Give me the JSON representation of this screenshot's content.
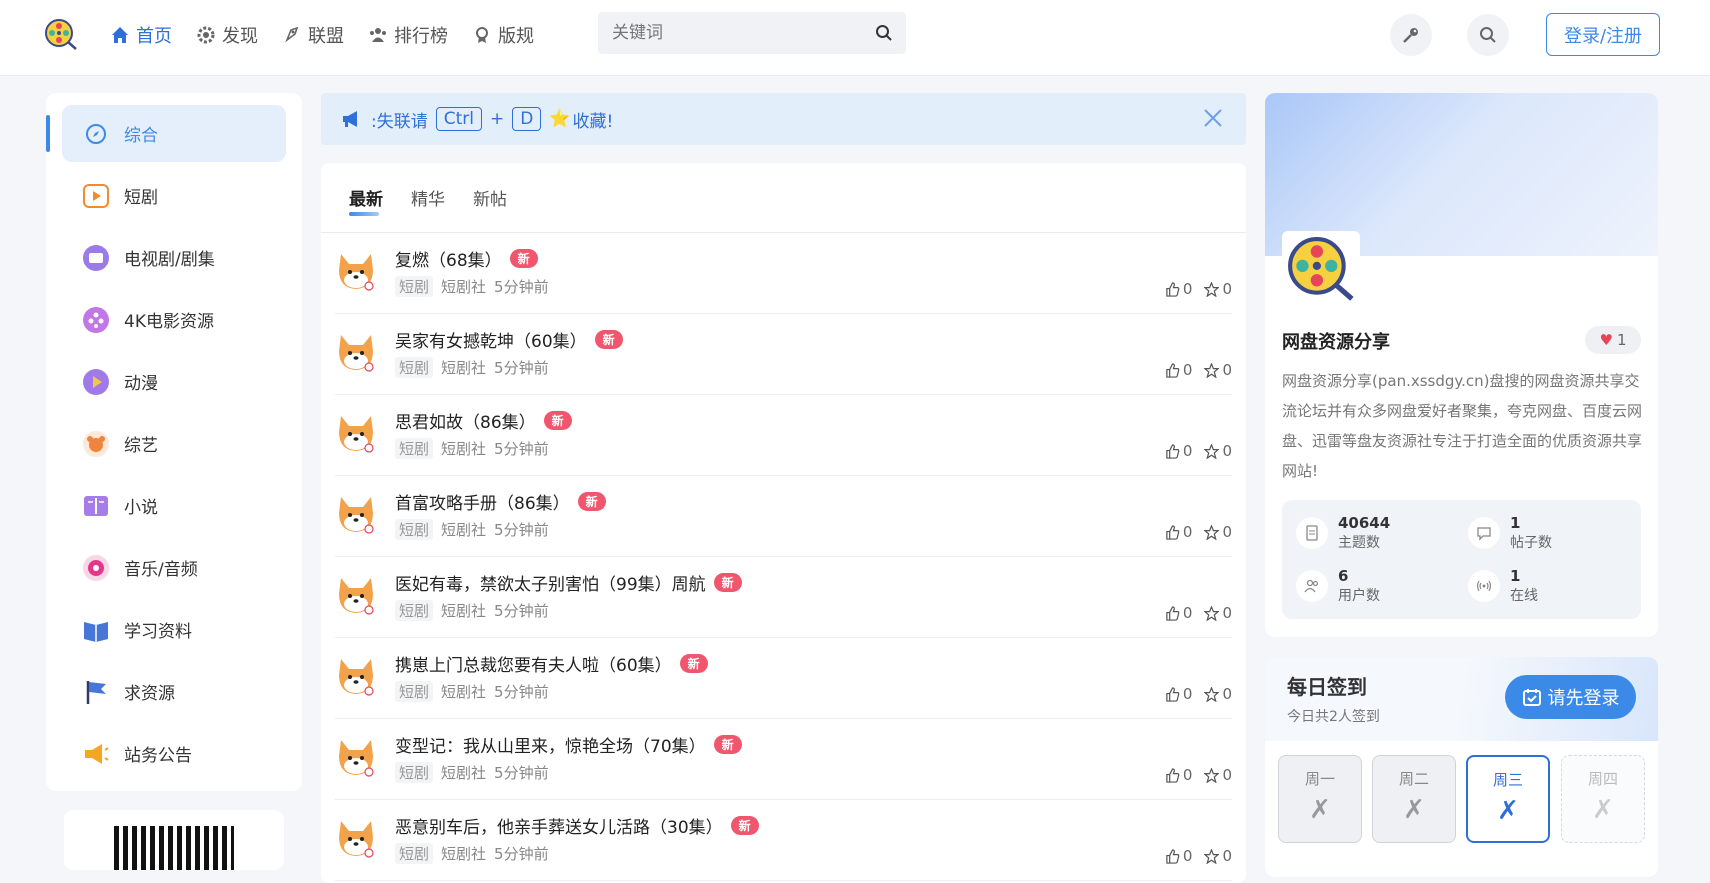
{
  "header": {
    "nav": [
      {
        "label": "首页",
        "icon": "home-icon"
      },
      {
        "label": "发现",
        "icon": "gear-icon"
      },
      {
        "label": "联盟",
        "icon": "rocket-icon"
      },
      {
        "label": "排行榜",
        "icon": "users-icon"
      },
      {
        "label": "版规",
        "icon": "award-icon"
      }
    ],
    "search_placeholder": "关键词",
    "login_label": "登录/注册"
  },
  "sidebar": {
    "items": [
      {
        "label": "综合",
        "icon": "compass-icon"
      },
      {
        "label": "短剧",
        "icon": "play-icon"
      },
      {
        "label": "电视剧/剧集",
        "icon": "tv-icon"
      },
      {
        "label": "4K电影资源",
        "icon": "film-reel-icon"
      },
      {
        "label": "动漫",
        "icon": "play-circle-icon"
      },
      {
        "label": "综艺",
        "icon": "bear-icon"
      },
      {
        "label": "小说",
        "icon": "book-icon"
      },
      {
        "label": "音乐/音频",
        "icon": "music-disc-icon"
      },
      {
        "label": "学习资料",
        "icon": "open-book-icon"
      },
      {
        "label": "求资源",
        "icon": "flag-icon"
      },
      {
        "label": "站务公告",
        "icon": "megaphone-icon"
      }
    ]
  },
  "notice": {
    "text_before": ":失联请",
    "key1": "Ctrl",
    "plus": "+",
    "key2": "D",
    "text_after": "收藏!"
  },
  "feed": {
    "tabs": [
      "最新",
      "精华",
      "新帖"
    ],
    "posts": [
      {
        "title": "复燃（68集）",
        "badge": "新",
        "tag": "短剧",
        "forum": "短剧社",
        "time": "5分钟前",
        "likes": "0",
        "favs": "0"
      },
      {
        "title": "吴家有女撼乾坤（60集）",
        "badge": "新",
        "tag": "短剧",
        "forum": "短剧社",
        "time": "5分钟前",
        "likes": "0",
        "favs": "0"
      },
      {
        "title": "思君如故（86集）",
        "badge": "新",
        "tag": "短剧",
        "forum": "短剧社",
        "time": "5分钟前",
        "likes": "0",
        "favs": "0"
      },
      {
        "title": "首富攻略手册（86集）",
        "badge": "新",
        "tag": "短剧",
        "forum": "短剧社",
        "time": "5分钟前",
        "likes": "0",
        "favs": "0"
      },
      {
        "title": "医妃有毒，禁欲太子别害怕（99集）周航",
        "badge": "新",
        "tag": "短剧",
        "forum": "短剧社",
        "time": "5分钟前",
        "likes": "0",
        "favs": "0"
      },
      {
        "title": "携崽上门总裁您要有夫人啦（60集）",
        "badge": "新",
        "tag": "短剧",
        "forum": "短剧社",
        "time": "5分钟前",
        "likes": "0",
        "favs": "0"
      },
      {
        "title": "变型记：我从山里来，惊艳全场（70集）",
        "badge": "新",
        "tag": "短剧",
        "forum": "短剧社",
        "time": "5分钟前",
        "likes": "0",
        "favs": "0"
      },
      {
        "title": "恶意别车后，他亲手葬送女儿活路（30集）",
        "badge": "新",
        "tag": "短剧",
        "forum": "短剧社",
        "time": "5分钟前",
        "likes": "0",
        "favs": "0"
      }
    ]
  },
  "profile": {
    "name": "网盘资源分享",
    "likes": "1",
    "description": "网盘资源分享(pan.xssdgy.cn)盘搜的网盘资源共享交流论坛并有众多网盘爱好者聚集，夸克网盘、百度云网盘、迅雷等盘友资源社专注于打造全面的优质资源共享网站!",
    "stats": [
      {
        "value": "40644",
        "label": "主题数",
        "icon": "document-icon"
      },
      {
        "value": "1",
        "label": "帖子数",
        "icon": "comment-icon"
      },
      {
        "value": "6",
        "label": "用户数",
        "icon": "users-icon"
      },
      {
        "value": "1",
        "label": "在线",
        "icon": "broadcast-icon"
      }
    ]
  },
  "signin": {
    "title": "每日签到",
    "subtitle": "今日共2人签到",
    "button": "请先登录",
    "days": [
      {
        "label": "周一",
        "mark": "✗"
      },
      {
        "label": "周二",
        "mark": "✗"
      },
      {
        "label": "周三",
        "mark": "✗"
      },
      {
        "label": "周四",
        "mark": "✗"
      }
    ]
  },
  "colors": {
    "accent": "#3c8ae8",
    "badge": "#f0566d"
  }
}
